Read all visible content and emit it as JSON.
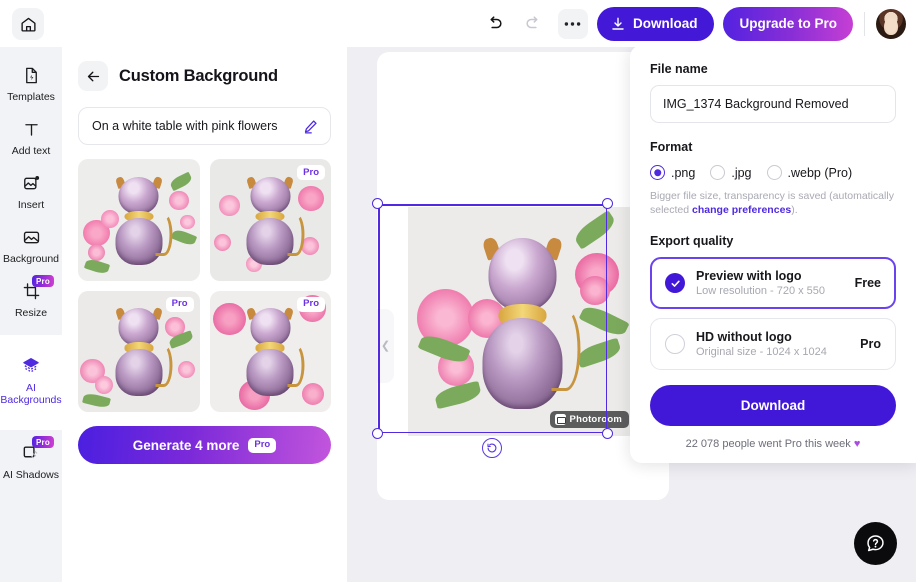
{
  "topbar": {
    "home_icon": "home-icon",
    "undo_icon": "undo-arrow-icon",
    "redo_icon": "redo-arrow-icon",
    "more_icon": "more-options-icon",
    "download_label": "Download",
    "download_icon": "download-icon",
    "upgrade_label": "Upgrade to Pro",
    "avatar_icon": "user-avatar"
  },
  "sidebar": {
    "items": [
      {
        "label": "Templates",
        "icon": "templates-icon",
        "pro": false,
        "active": false
      },
      {
        "label": "Add text",
        "icon": "text-icon",
        "pro": false,
        "active": false
      },
      {
        "label": "Insert",
        "icon": "insert-image-icon",
        "pro": false,
        "active": false
      },
      {
        "label": "Background",
        "icon": "background-image-icon",
        "pro": false,
        "active": false
      },
      {
        "label": "Resize",
        "icon": "crop-resize-icon",
        "pro": true,
        "active": false
      },
      {
        "label": "AI Backgrounds",
        "icon": "ai-layers-icon",
        "pro": false,
        "active": true
      },
      {
        "label": "AI Shadows",
        "icon": "shadow-square-icon",
        "pro": true,
        "active": false
      }
    ],
    "pro_badge": "Pro"
  },
  "panel": {
    "back_icon": "back-arrow-icon",
    "title": "Custom Background",
    "prompt_value": "On a white table with pink flowers",
    "edit_icon": "pencil-edit-icon",
    "thumbnails": [
      {
        "name": "background-result-1",
        "pro": false
      },
      {
        "name": "background-result-2",
        "pro": true
      },
      {
        "name": "background-result-3",
        "pro": true
      },
      {
        "name": "background-result-4",
        "pro": true
      }
    ],
    "pro_badge": "Pro",
    "generate_label": "Generate 4 more",
    "generate_pro_badge": "Pro"
  },
  "canvas": {
    "watermark_label": "Photoroom",
    "watermark_icon": "photoroom-logo-icon",
    "rotate_icon": "rotate-reset-icon",
    "collapse_left_icon": "chevron-left-icon",
    "collapse_right_icon": "chevron-right-icon"
  },
  "export": {
    "file_name_label": "File name",
    "file_name_value": "IMG_1374 Background Removed",
    "format_label": "Format",
    "formats": [
      {
        "label": ".png",
        "selected": true
      },
      {
        "label": ".jpg",
        "selected": false
      },
      {
        "label": ".webp (Pro)",
        "selected": false
      }
    ],
    "hint_before": "Bigger file size, transparency is saved (automatically selected ",
    "hint_link": "change preferences",
    "hint_after": ").",
    "quality_label": "Export quality",
    "qualities": [
      {
        "title": "Preview with logo",
        "subtitle": "Low resolution - 720 x 550",
        "tag": "Free",
        "selected": true
      },
      {
        "title": "HD without logo",
        "subtitle": "Original size - 1024 x 1024",
        "tag": "Pro",
        "selected": false
      }
    ],
    "download_label": "Download",
    "social_proof": "22 078 people went Pro this week",
    "heart_icon": "purple-heart-icon"
  },
  "help": {
    "icon": "help-question-icon"
  },
  "colors": {
    "accent": "#4218d8",
    "accent_light": "#6b43ee",
    "gradient_start": "#5322e0",
    "gradient_end": "#c63fd4",
    "canvas_bg": "#eeeef3",
    "rail_bg": "#f2f3f6"
  }
}
